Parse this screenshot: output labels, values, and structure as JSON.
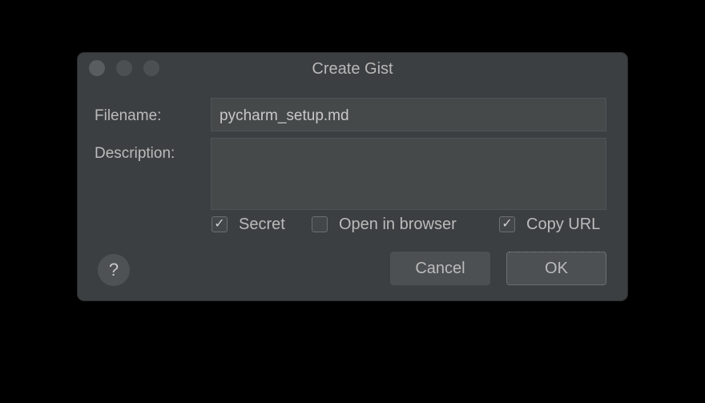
{
  "window": {
    "title": "Create Gist"
  },
  "form": {
    "filename_label": "Filename:",
    "filename_value": "pycharm_setup.md",
    "description_label": "Description:",
    "description_value": ""
  },
  "options": {
    "secret": {
      "label": "Secret",
      "checked": true,
      "mark": "✓"
    },
    "open_in_browser": {
      "label": "Open in browser",
      "checked": false,
      "mark": ""
    },
    "copy_url": {
      "label": "Copy URL",
      "checked": true,
      "mark": "✓"
    }
  },
  "buttons": {
    "help": "?",
    "cancel": "Cancel",
    "ok": "OK"
  },
  "colors": {
    "background": "#000000",
    "dialog": "#3c3f41",
    "input": "#45494a",
    "button": "#4c5052",
    "text": "#bbbbbb"
  }
}
